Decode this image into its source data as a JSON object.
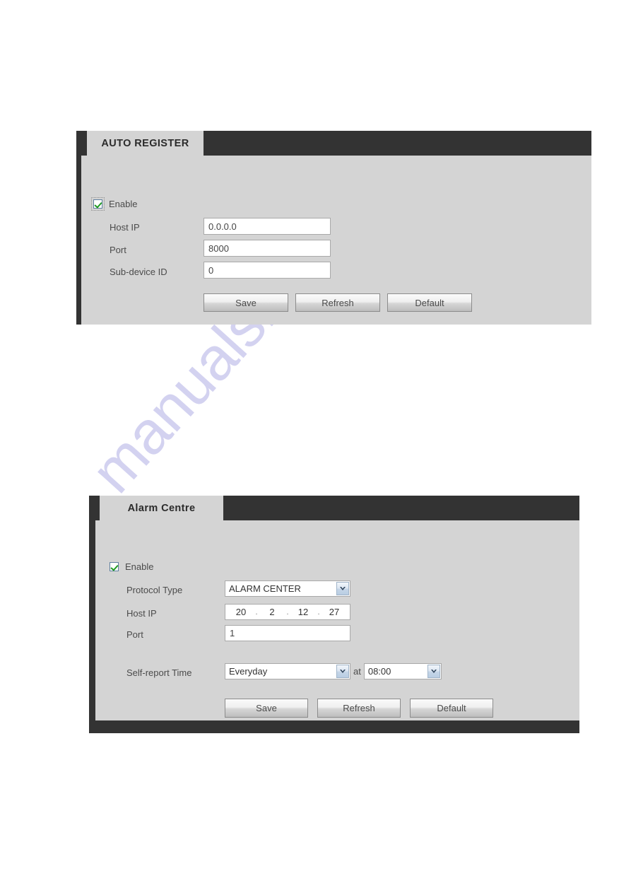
{
  "watermark": {
    "text": "manualshive.com",
    "color": "#b9b7e8"
  },
  "panels": [
    {
      "id": "auto_register",
      "tab_label": "AUTO REGISTER",
      "enable": {
        "label": "Enable",
        "checked": true
      },
      "fields": [
        {
          "label": "Host IP",
          "value": "0.0.0.0"
        },
        {
          "label": "Port",
          "value": "8000"
        },
        {
          "label": "Sub-device ID",
          "value": "0"
        }
      ],
      "buttons": {
        "save": "Save",
        "refresh": "Refresh",
        "default": "Default"
      }
    },
    {
      "id": "alarm_centre",
      "tab_label": "Alarm Centre",
      "enable": {
        "label": "Enable",
        "checked": true
      },
      "protocol": {
        "label": "Protocol Type",
        "value": "ALARM CENTER"
      },
      "host_ip": {
        "label": "Host IP",
        "octets": [
          "20",
          "2",
          "12",
          "27"
        ],
        "separator": "."
      },
      "port": {
        "label": "Port",
        "value": "1"
      },
      "self_report": {
        "label": "Self-report Time",
        "day_value": "Everyday",
        "at_label": "at",
        "time_value": "08:00"
      },
      "buttons": {
        "save": "Save",
        "refresh": "Refresh",
        "default": "Default"
      }
    }
  ]
}
